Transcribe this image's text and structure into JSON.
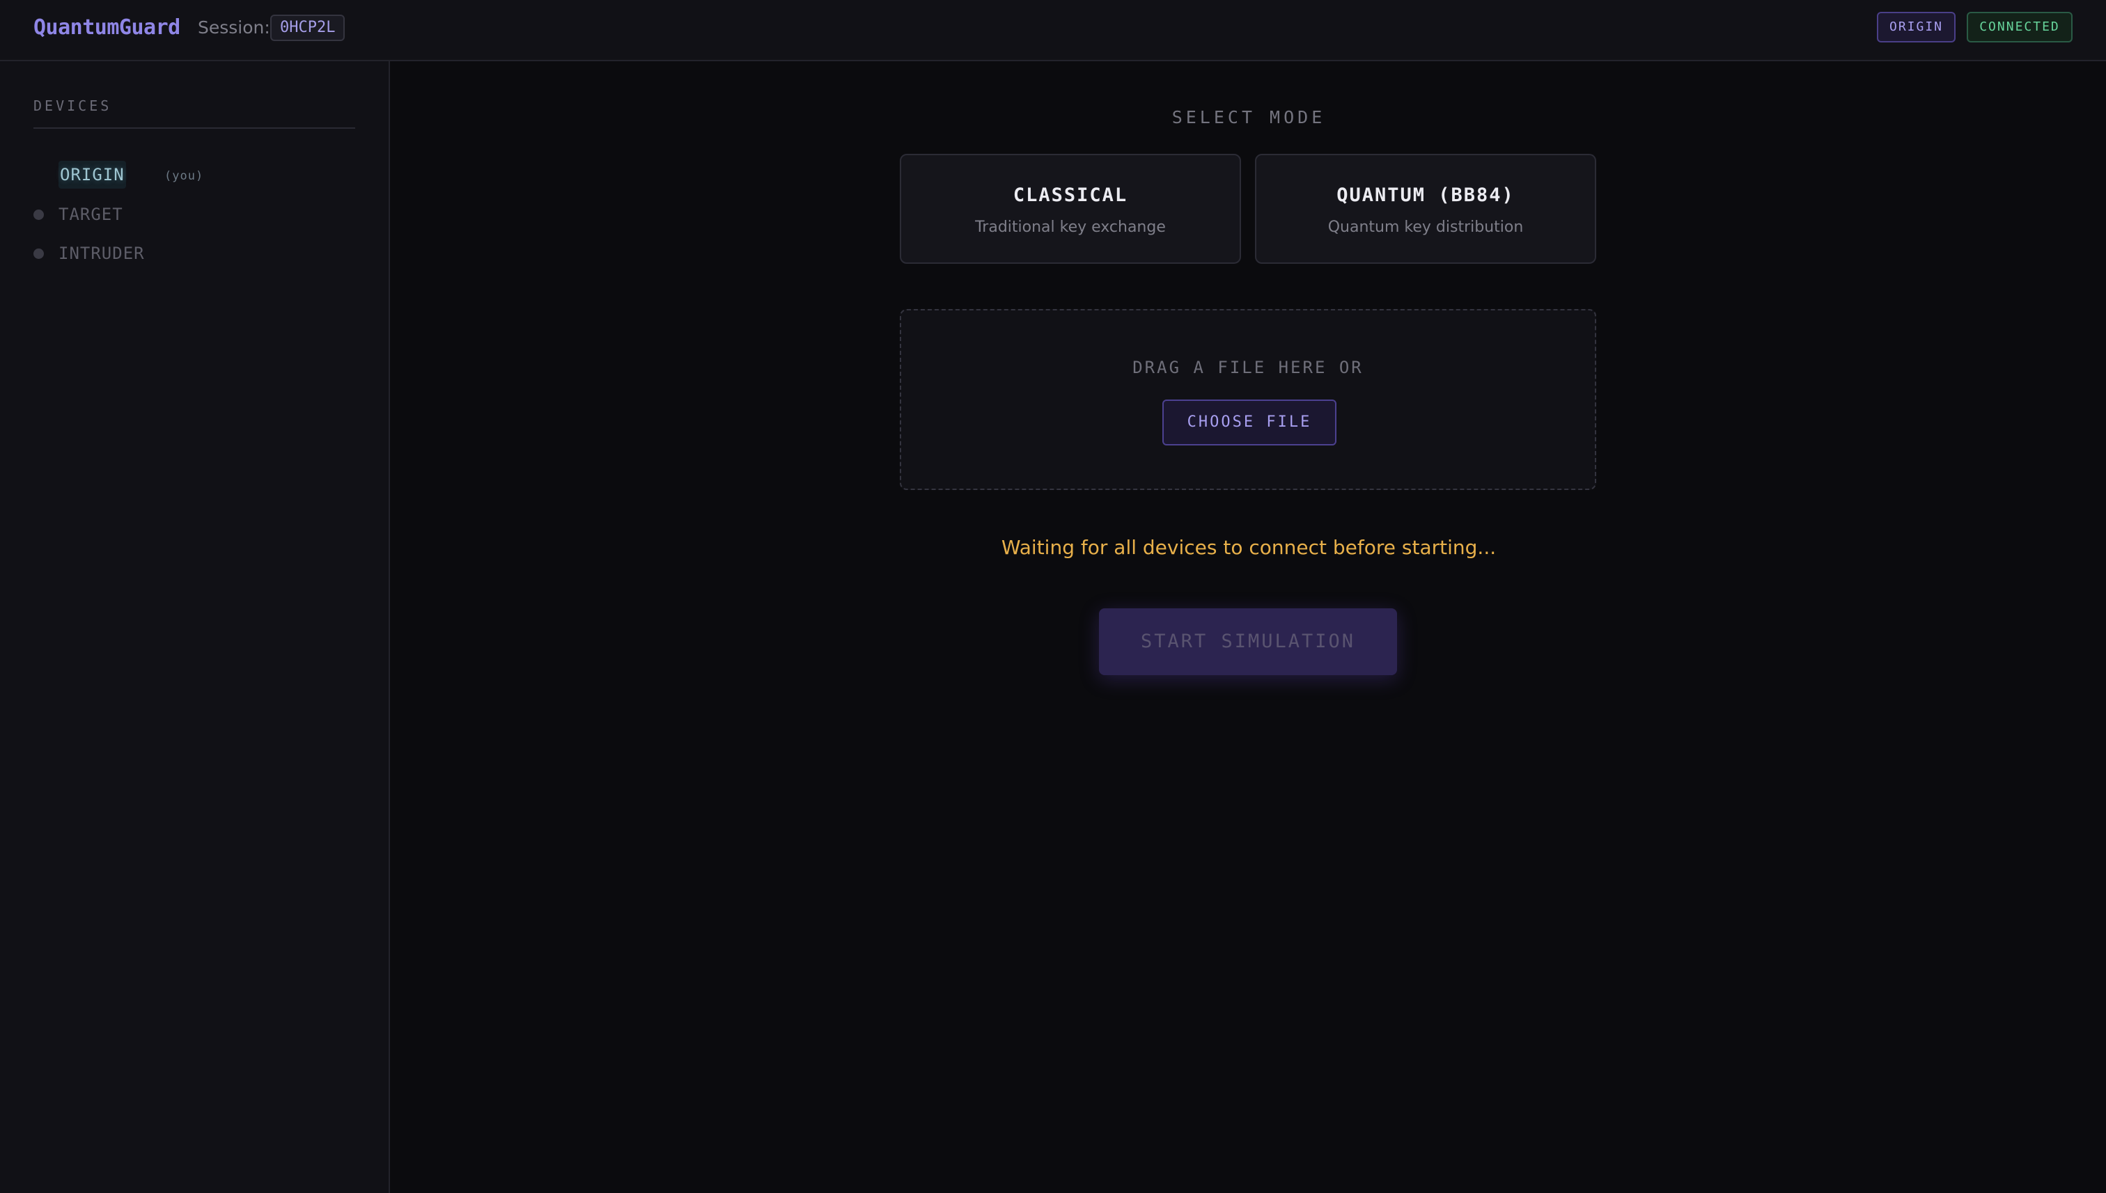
{
  "header": {
    "brand": "QuantumGuard",
    "session_label": "Session:",
    "session_code": "0HCP2L",
    "role_badge": "ORIGIN",
    "status_badge": "CONNECTED"
  },
  "sidebar": {
    "title": "DEVICES",
    "devices": [
      {
        "name": "ORIGIN",
        "suffix": "(you)",
        "active": true
      },
      {
        "name": "TARGET",
        "active": false
      },
      {
        "name": "INTRUDER",
        "active": false
      }
    ]
  },
  "main": {
    "select_mode_label": "SELECT MODE",
    "modes": [
      {
        "title": "CLASSICAL",
        "subtitle": "Traditional key exchange"
      },
      {
        "title": "QUANTUM (BB84)",
        "subtitle": "Quantum key distribution"
      }
    ],
    "dropzone": {
      "text": "DRAG A FILE HERE OR",
      "button": "CHOOSE FILE"
    },
    "waiting_message": "Waiting for all devices to connect before starting...",
    "start_button": "START SIMULATION",
    "start_enabled": false
  },
  "colors": {
    "background": "#0b0b0e",
    "accent": "#8f86e6",
    "connected": "#67d49b",
    "warning": "#e8b04a"
  }
}
